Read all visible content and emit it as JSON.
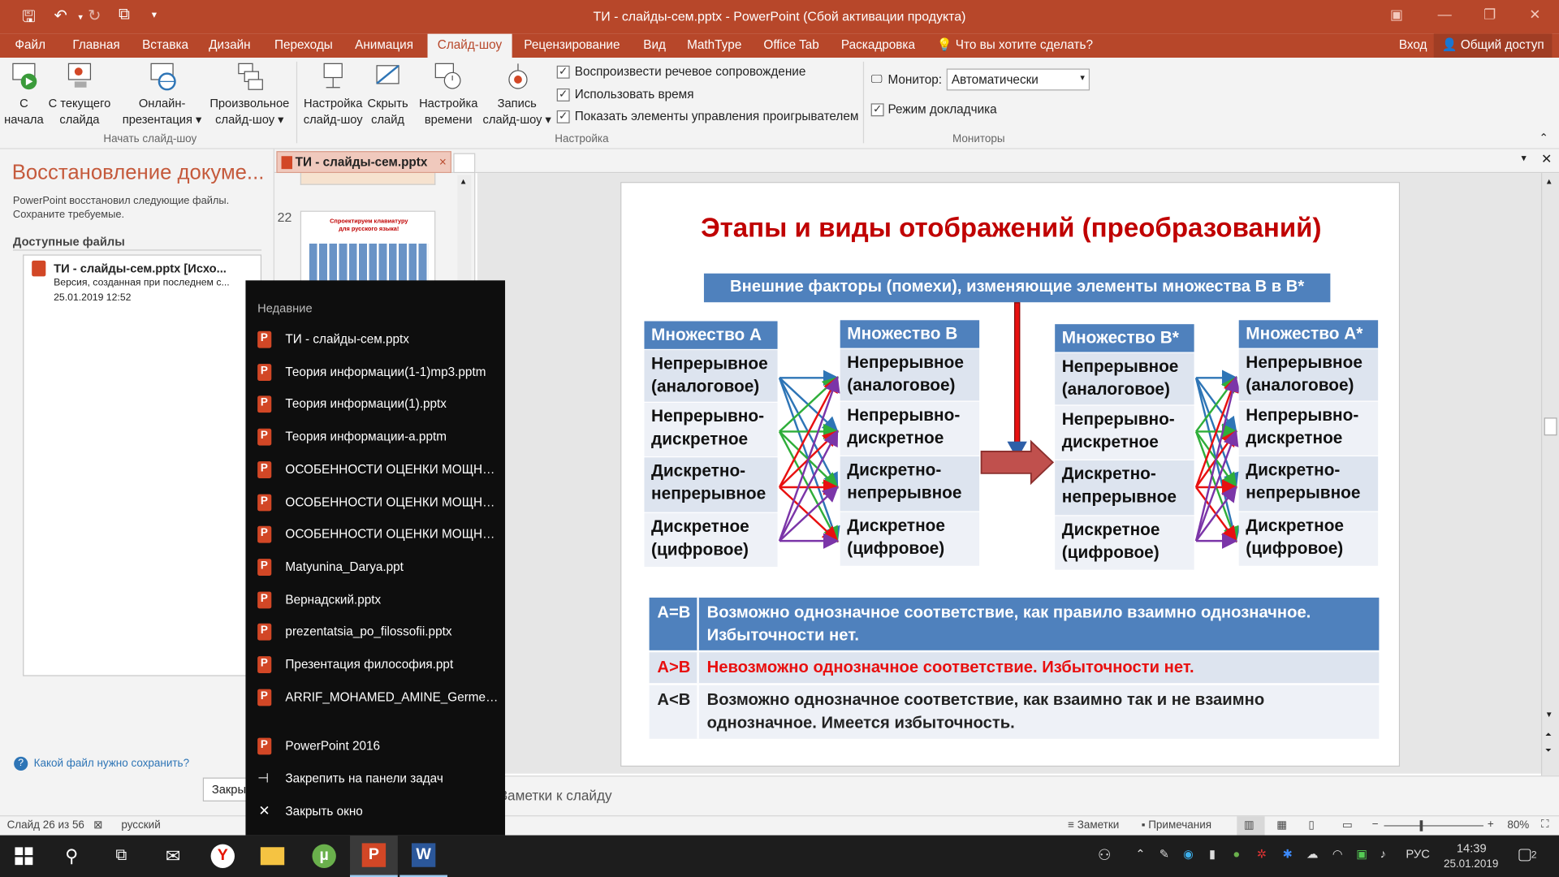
{
  "window": {
    "title": "ТИ - слайды-сем.pptx  -  PowerPoint (Сбой активации продукта)"
  },
  "menu": {
    "file": "Файл",
    "home": "Главная",
    "insert": "Вставка",
    "design": "Дизайн",
    "transitions": "Переходы",
    "animation": "Анимация",
    "slideshow": "Слайд-шоу",
    "review": "Рецензирование",
    "view": "Вид",
    "mathtype": "MathType",
    "officetab": "Office Tab",
    "storyboard": "Раскадровка",
    "tellme": "Что вы хотите сделать?",
    "signin": "Вход",
    "share": "Общий доступ"
  },
  "ribbon": {
    "from_start_1": "С",
    "from_start_2": "начала",
    "from_current_1": "С текущего",
    "from_current_2": "слайда",
    "online_1": "Онлайн-",
    "online_2": "презентация",
    "custom_1": "Произвольное",
    "custom_2": "слайд-шоу",
    "group_start": "Начать слайд-шоу",
    "setup_1": "Настройка",
    "setup_2": "слайд-шоу",
    "hide_1": "Скрыть",
    "hide_2": "слайд",
    "rehearse_1": "Настройка",
    "rehearse_2": "времени",
    "record_1": "Запись",
    "record_2": "слайд-шоу",
    "chk_narration": "Воспроизвести речевое сопровождение",
    "chk_timings": "Использовать время",
    "chk_controls": "Показать элементы управления проигрывателем",
    "group_setup": "Настройка",
    "monitor_label": "Монитор:",
    "monitor_value": "Автоматически",
    "chk_presenter": "Режим докладчика",
    "group_monitors": "Мониторы"
  },
  "recovery": {
    "title": "Восстановление докуме...",
    "desc_1": "PowerPoint восстановил следующие файлы.",
    "desc_2": "Сохраните требуемые.",
    "available": "Доступные файлы",
    "file_name": "ТИ - слайды-сем.pptx  [Исхо...",
    "file_desc": "Версия, созданная при последнем с...",
    "file_date": "25.01.2019 12:52",
    "help": "Какой файл нужно сохранить?",
    "close": "Закрыть"
  },
  "doctab": {
    "name": "ТИ - слайды-сем.pptx"
  },
  "thumbs": {
    "num": "22",
    "title_1": "Спроектируем клавиатуру",
    "title_2": "для русского языка!"
  },
  "jumplist": {
    "header": "Недавние",
    "recent": [
      "ТИ - слайды-сем.pptx",
      "Теория информации(1-1)mp3.pptm",
      "Теория информации(1).pptx",
      "Теория информации-а.pptm",
      "ОСОБЕННОСТИ ОЦЕНКИ МОЩНОСТ...",
      "ОСОБЕННОСТИ ОЦЕНКИ МОЩНОСТ...",
      "ОСОБЕННОСТИ ОЦЕНКИ МОЩНОСТ...",
      "Matyunina_Darya.ppt",
      "Вернадский.pptx",
      "prezentatsia_po_filossofii.pptx",
      "Презентация философия.ppt",
      "ARRIF_MOHAMED_AMINE_Germenevti..."
    ],
    "app": "PowerPoint 2016",
    "pin": "Закрепить на панели задач",
    "close": "Закрыть окно"
  },
  "slide": {
    "title": "Этапы и виды отображений (преобразований)",
    "factors": "Внешние факторы (помехи), изменяющие элементы множества В в В*",
    "set_a": "Множество А",
    "set_b": "Множество В",
    "set_b_star": "Множество В*",
    "set_a_star": "Множество А*",
    "rows": [
      [
        "Непрерывное",
        "(аналоговое)"
      ],
      [
        "Непрерывно-",
        "дискретное"
      ],
      [
        "Дискретно-",
        "непрерывное"
      ],
      [
        "Дискретное",
        "(цифровое)"
      ]
    ],
    "table": [
      {
        "k": "A=B",
        "v1": "Возможно однозначное соответствие, как правило взаимно однозначное.",
        "v2": "Избыточности нет."
      },
      {
        "k": "A>B",
        "v1": "Невозможно однозначное соответствие. Избыточности нет.",
        "v2": ""
      },
      {
        "k": "A<B",
        "v1": "Возможно однозначное соответствие, как взаимно так и не взаимно",
        "v2": "однозначное. Имеется избыточность."
      }
    ],
    "colors": {
      "title": "#c00000",
      "header": "#4f81bd",
      "red": "#e81010",
      "arrow_big": "#c0504d"
    }
  },
  "notes": {
    "placeholder": "Заметки к слайду"
  },
  "status": {
    "slide": "Слайд 26 из 56",
    "lang": "русский",
    "notes": "Заметки",
    "comments": "Примечания",
    "zoom": "80%"
  },
  "taskbar": {
    "lang": "РУС",
    "time": "14:39",
    "date": "25.01.2019",
    "notif": "2"
  }
}
